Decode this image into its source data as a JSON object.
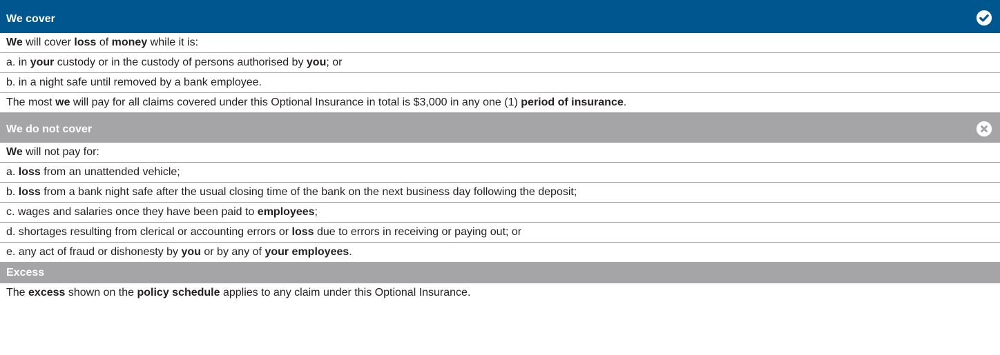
{
  "sections": [
    {
      "title": "We cover",
      "icon": "check-circle-icon",
      "color": "#00568f",
      "rows": [
        [
          {
            "t": "We",
            "b": true
          },
          {
            "t": " will cover "
          },
          {
            "t": "loss",
            "b": true
          },
          {
            "t": " of "
          },
          {
            "t": "money",
            "b": true
          },
          {
            "t": " while it is:"
          }
        ],
        [
          {
            "t": "a.  in "
          },
          {
            "t": "your",
            "b": true
          },
          {
            "t": " custody or in the custody of persons authorised by "
          },
          {
            "t": "you",
            "b": true
          },
          {
            "t": "; or"
          }
        ],
        [
          {
            "t": "b.  in a night safe until removed by a bank employee."
          }
        ],
        [
          {
            "t": "The most "
          },
          {
            "t": "we",
            "b": true
          },
          {
            "t": " will pay for all claims covered under this Optional Insurance in total is $3,000 in any one (1) "
          },
          {
            "t": "period of insurance",
            "b": true
          },
          {
            "t": "."
          }
        ]
      ]
    },
    {
      "title": "We do not cover",
      "icon": "x-circle-icon",
      "color": "#a5a5a8",
      "rows": [
        [
          {
            "t": "We",
            "b": true
          },
          {
            "t": " will not pay for:"
          }
        ],
        [
          {
            "t": "a.  "
          },
          {
            "t": "loss",
            "b": true
          },
          {
            "t": " from an unattended vehicle;"
          }
        ],
        [
          {
            "t": "b.  "
          },
          {
            "t": "loss",
            "b": true
          },
          {
            "t": " from a bank night safe after the usual closing time of the bank on the next business day following the deposit;"
          }
        ],
        [
          {
            "t": "c.  wages and salaries once they have been paid to "
          },
          {
            "t": "employees",
            "b": true
          },
          {
            "t": ";"
          }
        ],
        [
          {
            "t": "d.  shortages resulting from clerical or accounting errors or "
          },
          {
            "t": "loss",
            "b": true
          },
          {
            "t": " due to errors in receiving or paying out; or"
          }
        ],
        [
          {
            "t": "e.  any act of fraud or dishonesty by "
          },
          {
            "t": "you",
            "b": true
          },
          {
            "t": " or by any of "
          },
          {
            "t": "your employees",
            "b": true
          },
          {
            "t": "."
          }
        ]
      ]
    },
    {
      "title": "Excess",
      "icon": "",
      "color": "#a5a5a8",
      "rows": [
        [
          {
            "t": "The "
          },
          {
            "t": "excess",
            "b": true
          },
          {
            "t": " shown on the "
          },
          {
            "t": "policy schedule",
            "b": true
          },
          {
            "t": " applies to any claim under this Optional Insurance."
          }
        ]
      ]
    }
  ]
}
